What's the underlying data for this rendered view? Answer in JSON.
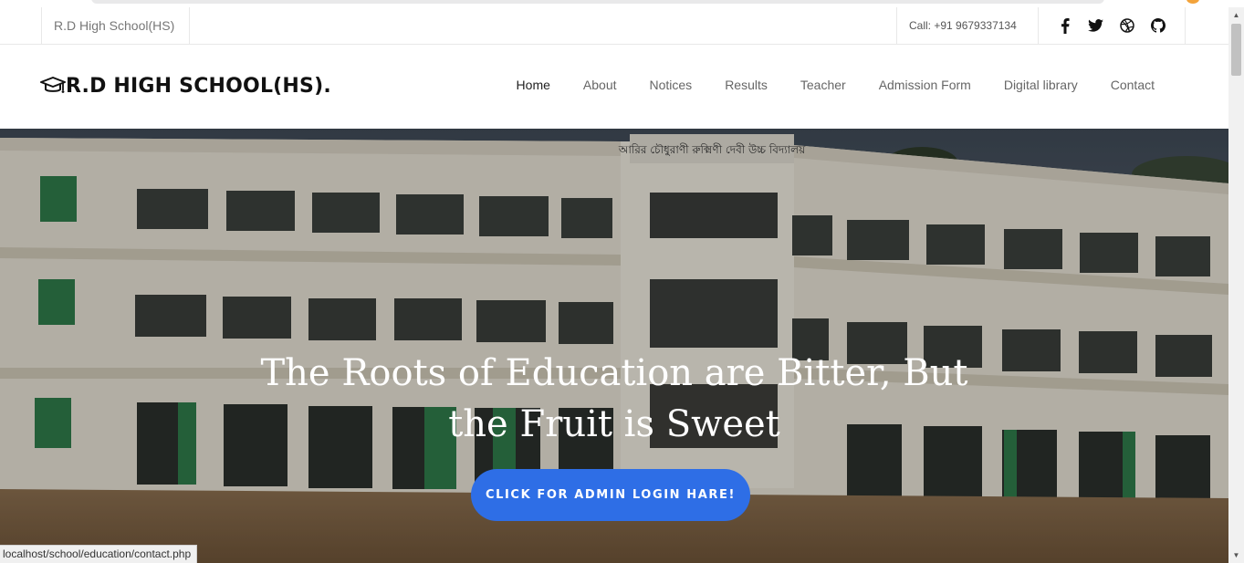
{
  "topbar": {
    "school_name": "R.D High School(HS)",
    "call": "Call: +91 9679337134",
    "social": [
      "facebook-icon",
      "twitter-icon",
      "dribbble-icon",
      "github-icon"
    ]
  },
  "navbar": {
    "brand": "R.D HIGH SCHOOL(HS).",
    "brand_icon": "graduation-cap-icon",
    "items": [
      {
        "label": "Home",
        "active": true
      },
      {
        "label": "About"
      },
      {
        "label": "Notices"
      },
      {
        "label": "Results"
      },
      {
        "label": "Teacher"
      },
      {
        "label": "Admission Form"
      },
      {
        "label": "Digital library"
      },
      {
        "label": "Contact"
      }
    ]
  },
  "hero": {
    "title_line1": "The Roots of Education are Bitter, But",
    "title_line2": "the Fruit is Sweet",
    "cta": "CLICK FOR ADMIN LOGIN HARE!",
    "sign_text": "আরির চৌধুরাণী রুক্মিণী দেবী উচ্চ বিদ্যালয়"
  },
  "status_bar": {
    "url": "localhost/school/education/contact.php"
  },
  "colors": {
    "accent": "#2e6ee6",
    "building": "#e9e4d8",
    "window_green": "#2f7a4a"
  }
}
